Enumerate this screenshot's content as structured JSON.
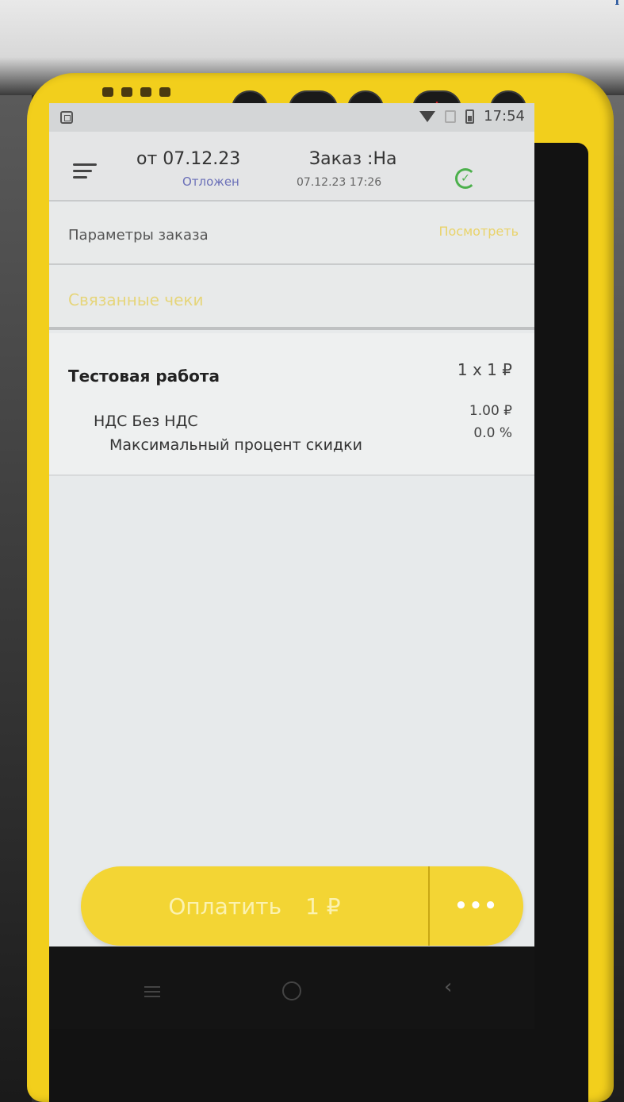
{
  "status_bar": {
    "time": "17:54",
    "icons": [
      "screenshot-app-icon",
      "wifi-icon",
      "signal-icon",
      "battery-icon"
    ]
  },
  "header": {
    "date_label": "от 07.12.23",
    "status": "Отложен",
    "order_label": "Заказ :На",
    "order_datetime": "07.12.23 17:26",
    "icons": [
      "menu-icon",
      "sync-icon"
    ]
  },
  "params": {
    "label": "Параметры заказа",
    "view_link": "Посмотреть"
  },
  "linked_checks": {
    "label": "Связанные чеки"
  },
  "item": {
    "name": "Тестовая работа",
    "quantity_price": "1 х 1 ₽",
    "vat_label": "НДС Без НДС",
    "vat_amount": "1.00 ₽",
    "discount_label": "Максимальный процент скидки",
    "discount_value": "0.0 %"
  },
  "pay": {
    "label": "Оплатить",
    "amount": "1 ₽",
    "more": "•••"
  },
  "colors": {
    "device_yellow": "#f2cf1c",
    "pay_button": "#f3d534",
    "accent_link": "#e9d36a",
    "status_blue": "#6a6fb8",
    "sync_green": "#4cb04c"
  }
}
